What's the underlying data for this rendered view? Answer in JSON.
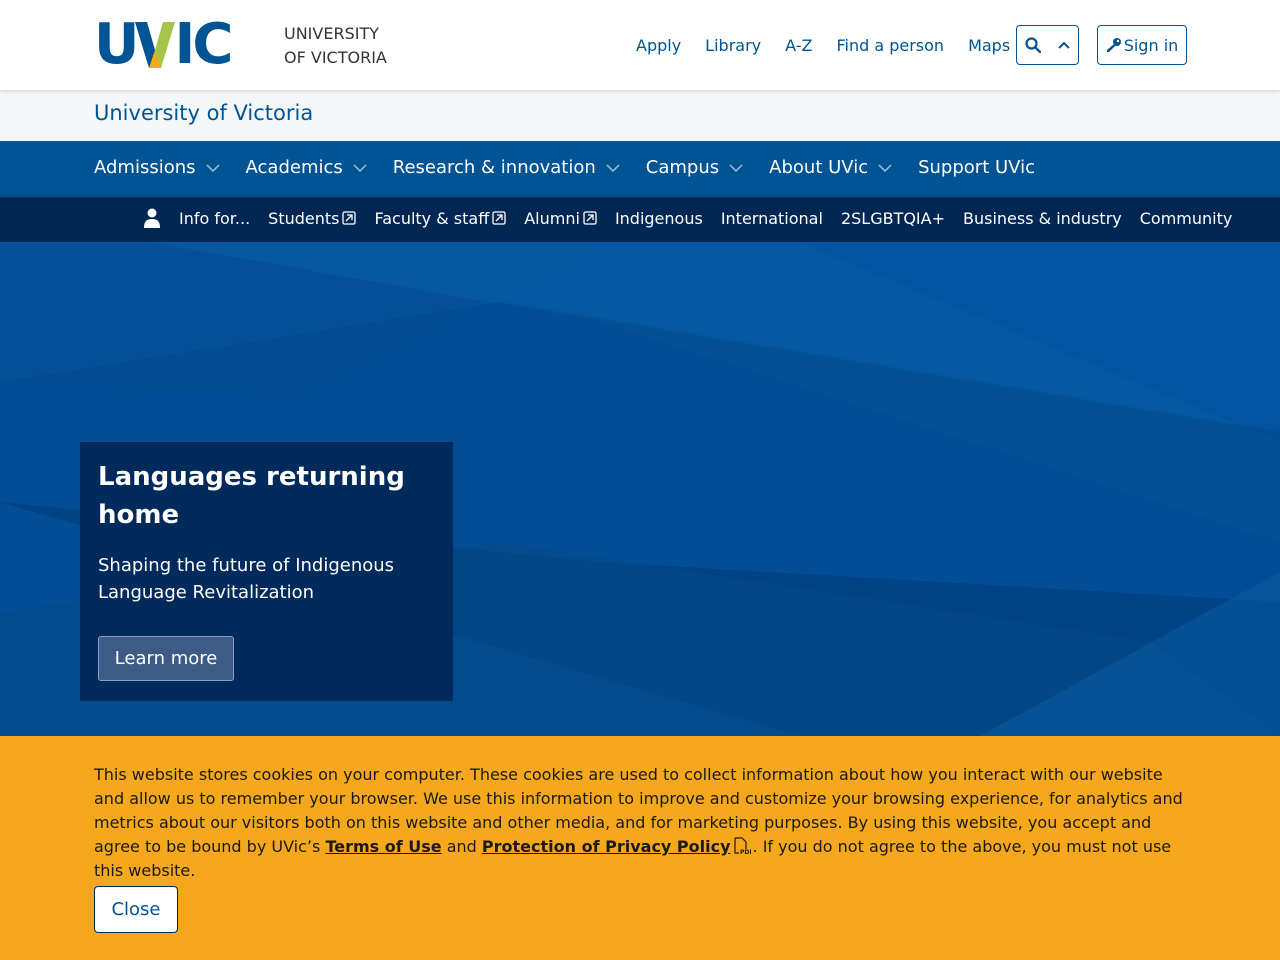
{
  "header": {
    "logo_text": "UVIC",
    "university_line1": "UNIVERSITY",
    "university_line2": "OF VICTORIA",
    "links": [
      "Apply",
      "Library",
      "A-Z",
      "Find a person",
      "Maps"
    ],
    "signin_label": "Sign in"
  },
  "site_title": "University of Victoria",
  "main_nav": [
    "Admissions",
    "Academics",
    "Research & innovation",
    "Campus",
    "About UVic",
    "Support UVic"
  ],
  "audience_nav": {
    "label": "Info for...",
    "items": [
      {
        "label": "Students",
        "external": true
      },
      {
        "label": "Faculty & staff",
        "external": true
      },
      {
        "label": "Alumni",
        "external": true
      },
      {
        "label": "Indigenous",
        "external": false
      },
      {
        "label": "International",
        "external": false
      },
      {
        "label": "2SLGBTQIA+",
        "external": false
      },
      {
        "label": "Business & industry",
        "external": false
      },
      {
        "label": "Community",
        "external": false
      }
    ]
  },
  "hero": {
    "title": "Languages returning home",
    "subtitle": "Shaping the future of Indigenous Language Revitalization",
    "button_label": "Learn more"
  },
  "cookie": {
    "text_before": "This website stores cookies on your computer. These cookies are used to collect information about how you interact with our website and allow us to remember your browser. We use this information to improve and customize your browsing experience, for analytics and metrics about our visitors both on this website and other media, and for marketing purposes. By using this website, you accept and agree to be bound by UVic’s ",
    "terms_link": "Terms of Use",
    "and_text": " and ",
    "privacy_link": "Protection of Privacy Policy",
    "text_after": ". If you do not agree to the above, you must not use this website.",
    "close_label": "Close"
  },
  "colors": {
    "brand_blue": "#005493",
    "dark_navy": "#002754",
    "cookie_yellow": "#f5a81c",
    "logo_green": "#a4c44a",
    "logo_gold": "#f5aa1c"
  }
}
